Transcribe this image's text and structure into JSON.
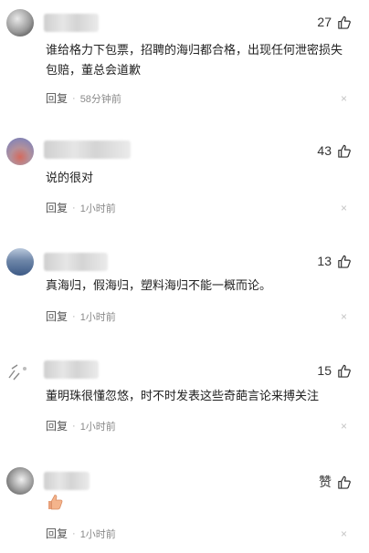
{
  "comments": [
    {
      "likes": "27",
      "text": "谁给格力下包票，招聘的海归都合格，出现任何泄密损失包赔，董总会道歉",
      "reply_label": "回复",
      "time": "58分钟前",
      "close": "×"
    },
    {
      "likes": "43",
      "text": "说的很对",
      "reply_label": "回复",
      "time": "1小时前",
      "close": "×"
    },
    {
      "likes": "13",
      "text": "真海归，假海归，塑料海归不能一概而论。",
      "reply_label": "回复",
      "time": "1小时前",
      "close": "×"
    },
    {
      "likes": "15",
      "text": "董明珠很懂忽悠，时不时发表这些奇葩言论来搏关注",
      "reply_label": "回复",
      "time": "1小时前",
      "close": "×"
    },
    {
      "likes": "赞",
      "text": "",
      "emoji": "👍",
      "reply_label": "回复",
      "time": "1小时前",
      "close": "×"
    }
  ],
  "icons": {
    "like": "thumbs-up-icon",
    "close": "close-icon"
  },
  "colors": {
    "text": "#222222",
    "meta": "#8a8a8a",
    "close": "#c4c4c4"
  }
}
